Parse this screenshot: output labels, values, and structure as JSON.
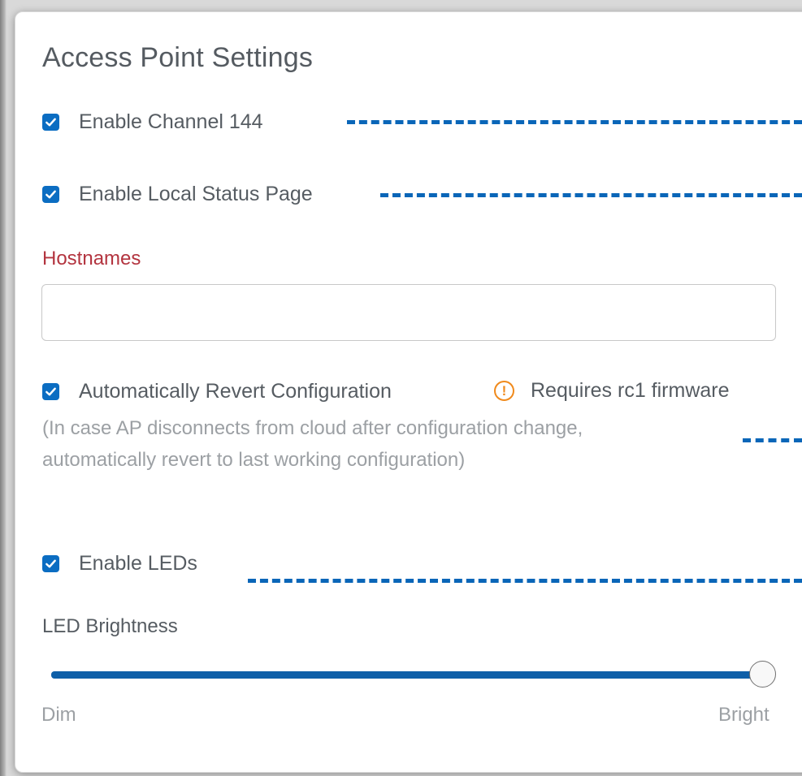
{
  "panel": {
    "title": "Access Point Settings"
  },
  "options": {
    "channel144": {
      "label": "Enable Channel 144",
      "checked": true
    },
    "local_status": {
      "label": "Enable Local Status Page",
      "checked": true
    },
    "auto_revert": {
      "label": "Automatically Revert Configuration",
      "checked": true,
      "warning": "Requires rc1 firmware",
      "help": "(In case AP disconnects from cloud after configuration change, automatically revert to last working configuration)"
    },
    "leds": {
      "label": "Enable LEDs",
      "checked": true
    }
  },
  "hostnames": {
    "label": "Hostnames",
    "value": "",
    "placeholder": ""
  },
  "brightness": {
    "label": "LED Brightness",
    "min_label": "Dim",
    "max_label": "Bright",
    "level": 1.0
  },
  "colors": {
    "accent": "#0b6dc2",
    "required_label": "#b3343f",
    "warning": "#f08a1c",
    "callout_dash": "#0a66b8"
  },
  "icons": {
    "checkbox": "checkmark-icon",
    "warning": "exclamation-circle-icon"
  }
}
